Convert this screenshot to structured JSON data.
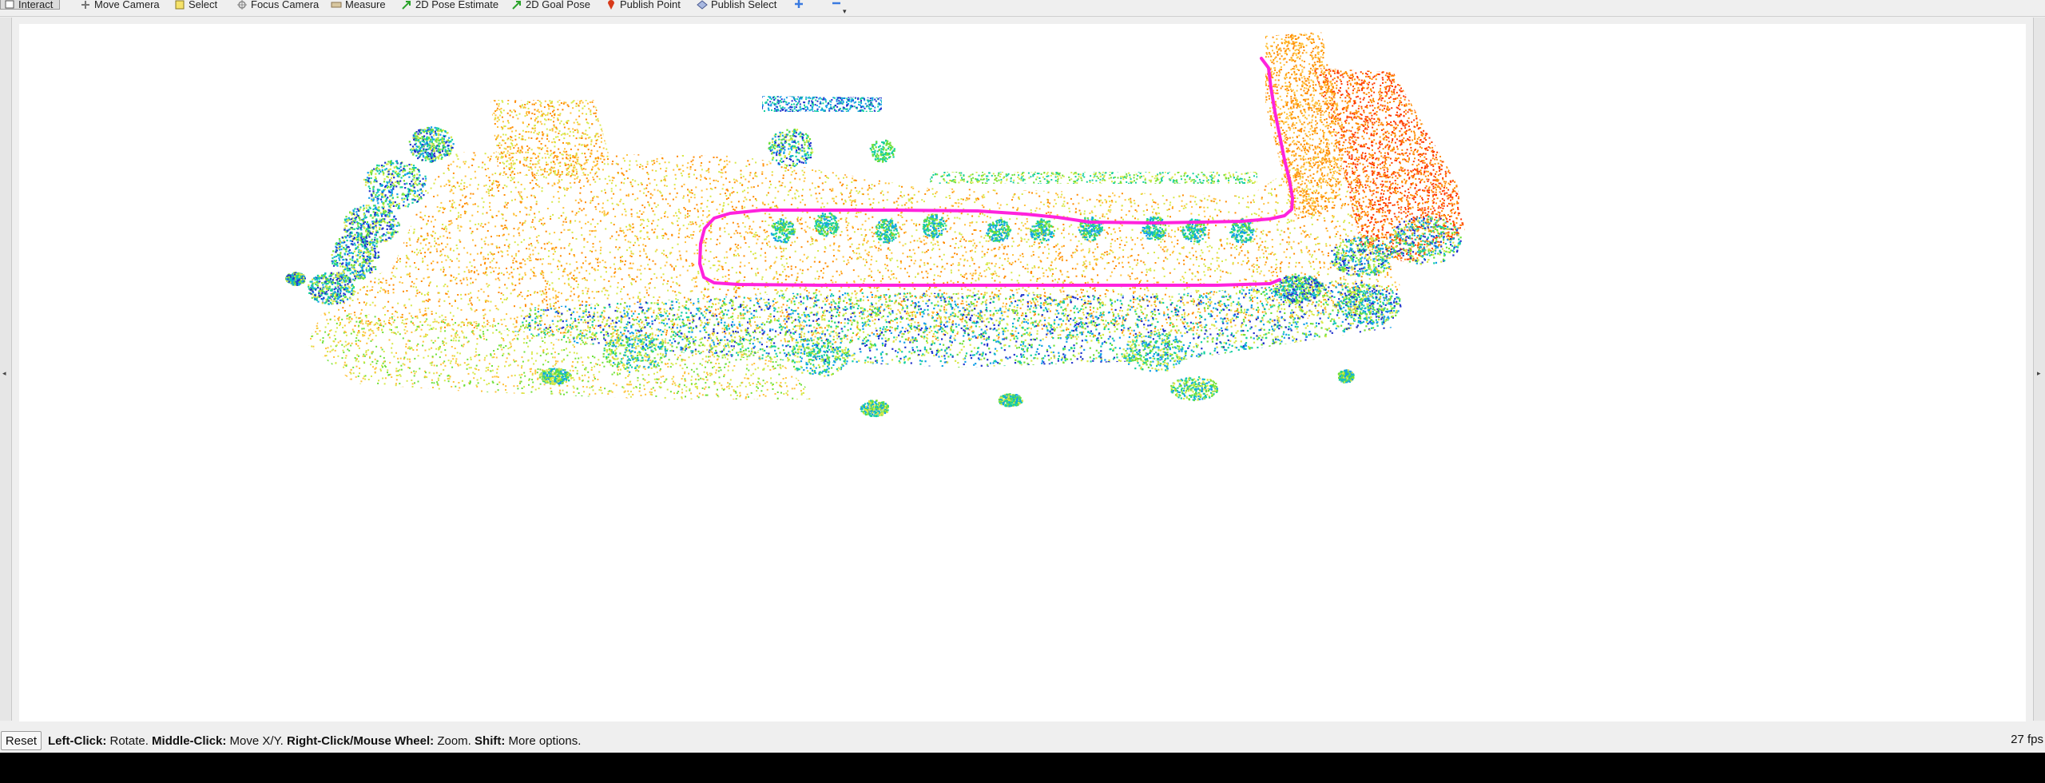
{
  "toolbar": {
    "tools": [
      {
        "label": "Interact",
        "icon": "interact-icon",
        "active": true
      },
      {
        "label": "Move Camera",
        "icon": "move-camera-icon"
      },
      {
        "label": "Select",
        "icon": "select-icon"
      },
      {
        "label": "Focus Camera",
        "icon": "focus-camera-icon"
      },
      {
        "label": "Measure",
        "icon": "measure-icon"
      },
      {
        "label": "2D Pose Estimate",
        "icon": "pose-estimate-arrow-icon"
      },
      {
        "label": "2D Goal Pose",
        "icon": "goal-pose-arrow-icon"
      },
      {
        "label": "Publish Point",
        "icon": "publish-point-pin-icon"
      },
      {
        "label": "Publish Select",
        "icon": "publish-select-icon"
      }
    ],
    "add_tool_icon": "plus-icon",
    "remove_tool_icon": "minus-icon"
  },
  "viewport": {
    "background": "#ffffff",
    "trajectory_color": "#ff22dd",
    "colormap": [
      "#ff3a00",
      "#ff8a00",
      "#ffc13a",
      "#d8e84a",
      "#6fe038",
      "#14cfa0",
      "#12a0e8",
      "#2133cc"
    ]
  },
  "statusbar": {
    "reset_label": "Reset",
    "hint": [
      {
        "key": "Left-Click:",
        "text": " Rotate. "
      },
      {
        "key": "Middle-Click:",
        "text": " Move X/Y. "
      },
      {
        "key": "Right-Click/Mouse Wheel:",
        "text": " Zoom. "
      },
      {
        "key": "Shift:",
        "text": " More options."
      }
    ],
    "fps": "27 fps"
  }
}
